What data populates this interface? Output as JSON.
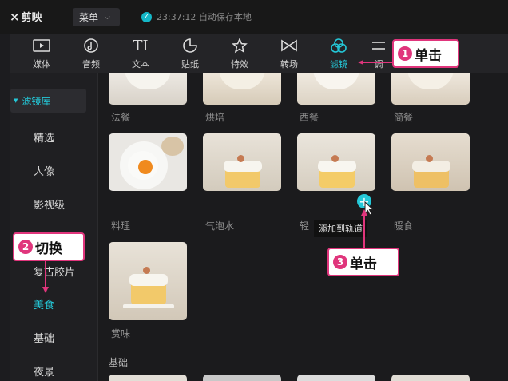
{
  "app": {
    "logo_text": "剪映",
    "menu_label": "菜单",
    "save_status": "23:37:12 自动保存本地"
  },
  "toolbar": {
    "items": [
      {
        "label": "媒体",
        "icon": "media-icon"
      },
      {
        "label": "音频",
        "icon": "audio-icon"
      },
      {
        "label": "文本",
        "icon": "text-icon"
      },
      {
        "label": "贴纸",
        "icon": "sticker-icon"
      },
      {
        "label": "特效",
        "icon": "effects-icon"
      },
      {
        "label": "转场",
        "icon": "transition-icon"
      },
      {
        "label": "滤镜",
        "icon": "filter-icon",
        "active": true
      },
      {
        "label": "调",
        "icon": "adjust-icon"
      }
    ]
  },
  "sidebar": {
    "header": "滤镜库",
    "items": [
      "精选",
      "人像",
      "影视级",
      "复古胶片",
      "美食",
      "基础",
      "夜景"
    ],
    "active_item": "美食"
  },
  "grid": {
    "row0": [
      "法餐",
      "烘培",
      "西餐",
      "简餐"
    ],
    "row1": [
      "料理",
      "气泡水",
      "轻",
      "暖食"
    ],
    "row2": [
      "赏味"
    ],
    "section_label": "基础",
    "tooltip": "添加到轨道"
  },
  "annotations": {
    "a1": {
      "num": "1",
      "text": "单击"
    },
    "a2": {
      "num": "2",
      "text": "切换"
    },
    "a3": {
      "num": "3",
      "text": "单击"
    }
  },
  "colors": {
    "accent": "#24c8d8",
    "annotation": "#e0357c"
  }
}
